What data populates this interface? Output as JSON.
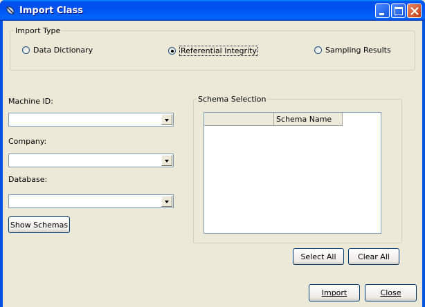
{
  "window": {
    "title": "Import Class"
  },
  "import_type": {
    "label": "Import Type",
    "options": [
      {
        "label": "Data Dictionary",
        "checked": false
      },
      {
        "label": "Referential Integrity",
        "checked": true
      },
      {
        "label": "Sampling Results",
        "checked": false
      }
    ]
  },
  "left": {
    "machine_id_label": "Machine ID:",
    "machine_id_value": "",
    "company_label": "Company:",
    "company_value": "",
    "database_label": "Database:",
    "database_value": "",
    "show_schemas_button": "Show Schemas"
  },
  "schema": {
    "label": "Schema Selection",
    "columns": [
      "",
      "Schema Name"
    ],
    "select_all_button": "Select All",
    "clear_all_button": "Clear All"
  },
  "footer": {
    "import_button": "Import",
    "close_button": "Close"
  }
}
